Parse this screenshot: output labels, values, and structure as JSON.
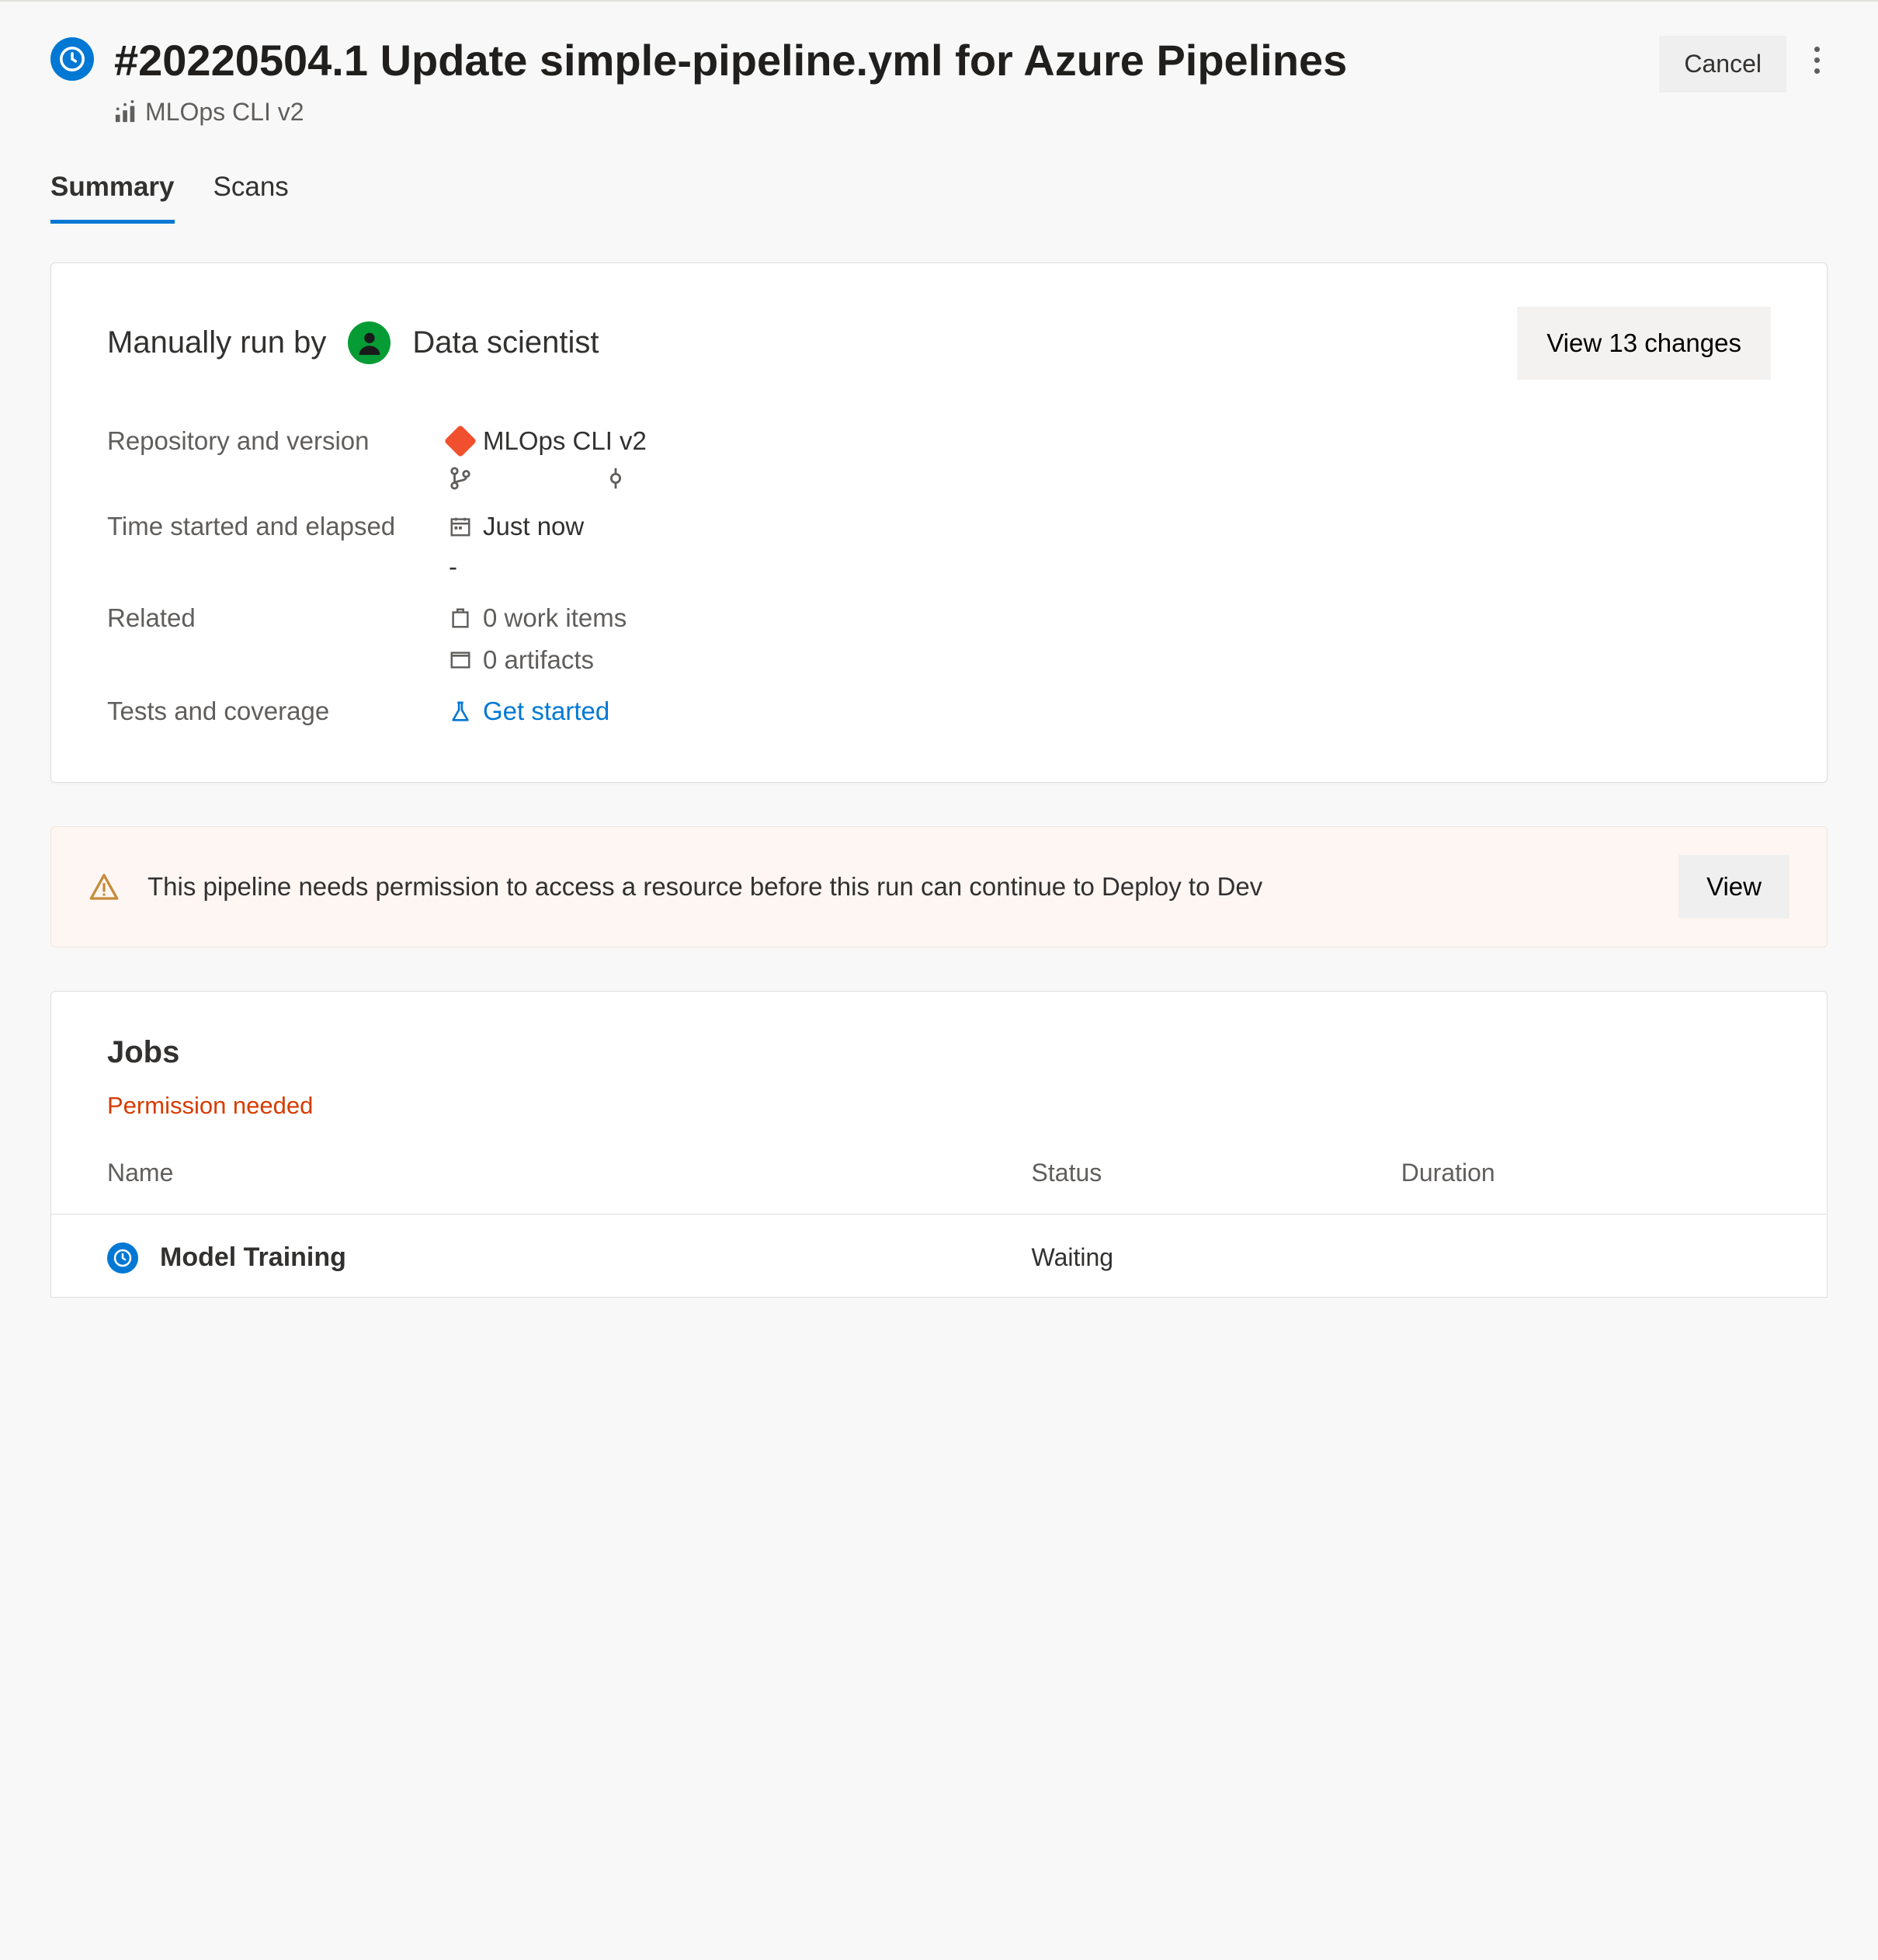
{
  "header": {
    "title": "#20220504.1 Update simple-pipeline.yml for Azure Pipelines",
    "pipeline_name": "MLOps CLI v2",
    "cancel_label": "Cancel"
  },
  "tabs": [
    {
      "label": "Summary",
      "active": true
    },
    {
      "label": "Scans",
      "active": false
    }
  ],
  "run_card": {
    "run_by_label": "Manually run by",
    "run_by_user": "Data scientist",
    "view_changes_label": "View 13 changes",
    "meta": {
      "repo_label": "Repository and version",
      "repo_value": "MLOps CLI v2",
      "time_label": "Time started and elapsed",
      "time_started": "Just now",
      "time_elapsed": "-",
      "related_label": "Related",
      "work_items": "0 work items",
      "artifacts": "0 artifacts",
      "tests_label": "Tests and coverage",
      "tests_link": "Get started"
    }
  },
  "alert": {
    "message": "This pipeline needs permission to access a resource before this run can continue to Deploy to Dev",
    "view_label": "View"
  },
  "jobs": {
    "title": "Jobs",
    "permission_needed": "Permission needed",
    "columns": {
      "name": "Name",
      "status": "Status",
      "duration": "Duration"
    },
    "rows": [
      {
        "name": "Model Training",
        "status": "Waiting",
        "duration": ""
      }
    ]
  }
}
